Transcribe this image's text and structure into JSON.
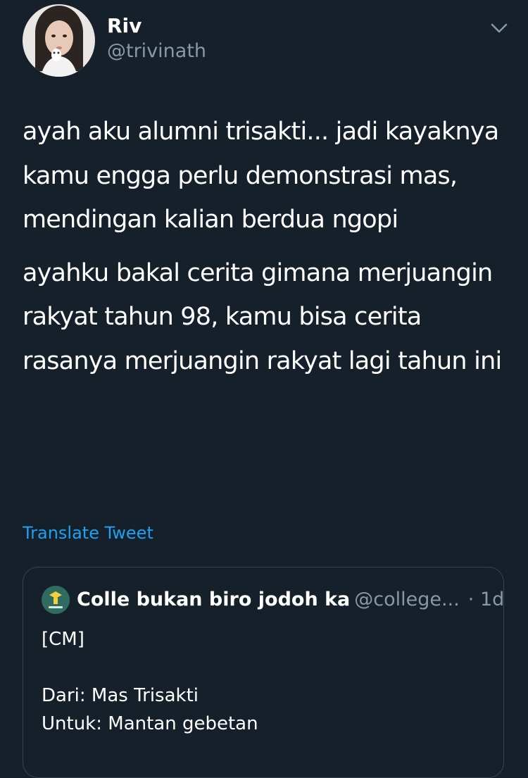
{
  "author": {
    "display_name": "Riv",
    "handle": "@trivinath"
  },
  "tweet": {
    "paragraphs": [
      "ayah aku alumni trisakti... jadi kayaknya kamu engga perlu demonstrasi mas, mendingan kalian berdua ngopi",
      "ayahku bakal cerita gimana merjuangin rakyat tahun 98, kamu bisa cerita rasanya merjuangin rakyat lagi tahun ini"
    ],
    "translate_label": "Translate Tweet"
  },
  "quoted_tweet": {
    "display_name": "Colle bukan biro jodoh ka",
    "handle": "@college...",
    "separator": "·",
    "time": "1d",
    "lines": [
      "[CM]",
      "",
      "Dari: Mas Trisakti",
      "Untuk: Mantan gebetan"
    ]
  },
  "icons": {
    "caret": "chevron-down-icon",
    "avatar": "profile-photo",
    "quote_avatar": "college-logo"
  },
  "colors": {
    "background": "#15202b",
    "text": "#ffffff",
    "muted": "#8899a6",
    "link": "#1da1f2",
    "border": "#38444d"
  }
}
